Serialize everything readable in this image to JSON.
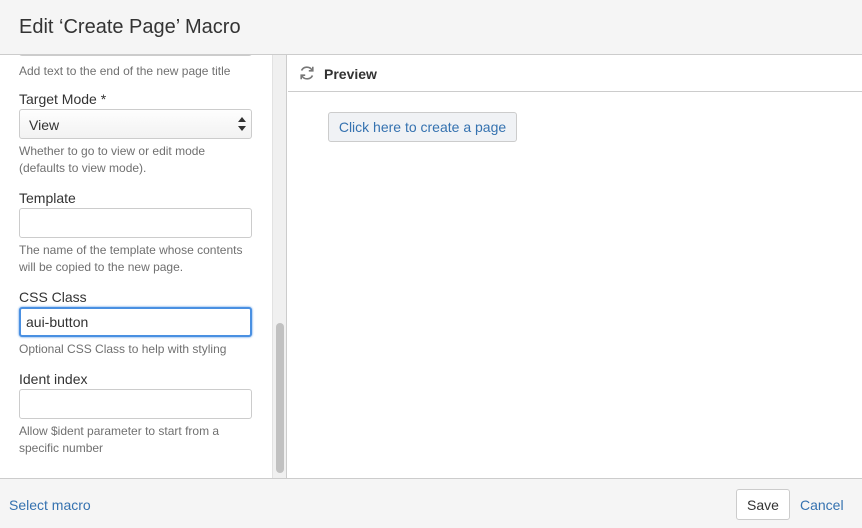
{
  "dialog": {
    "title": "Edit ‘Create Page’ Macro"
  },
  "form": {
    "title_suffix_hint": "Add text to the end of the new page title",
    "target_mode": {
      "label": "Target Mode *",
      "value": "View",
      "hint_line1": "Whether to go to view or edit mode",
      "hint_line2": "(defaults to view mode)."
    },
    "template": {
      "label": "Template",
      "value": "",
      "hint_line1": "The name of the template whose contents",
      "hint_line2": "will be copied to the new page."
    },
    "css_class": {
      "label": "CSS Class",
      "value": "aui-button",
      "hint": "Optional CSS Class to help with styling"
    },
    "ident_index": {
      "label": "Ident index",
      "value": "",
      "hint_line1": "Allow $ident parameter to start from a",
      "hint_line2": "specific number"
    }
  },
  "preview": {
    "label": "Preview",
    "button_label": "Click here to create a page"
  },
  "footer": {
    "select_macro": "Select macro",
    "save": "Save",
    "cancel": "Cancel"
  },
  "colors": {
    "link": "#3572b0",
    "focus": "#4a90e2"
  },
  "icons": {
    "preview": "refresh-icon",
    "select": "updown-arrows-icon"
  }
}
